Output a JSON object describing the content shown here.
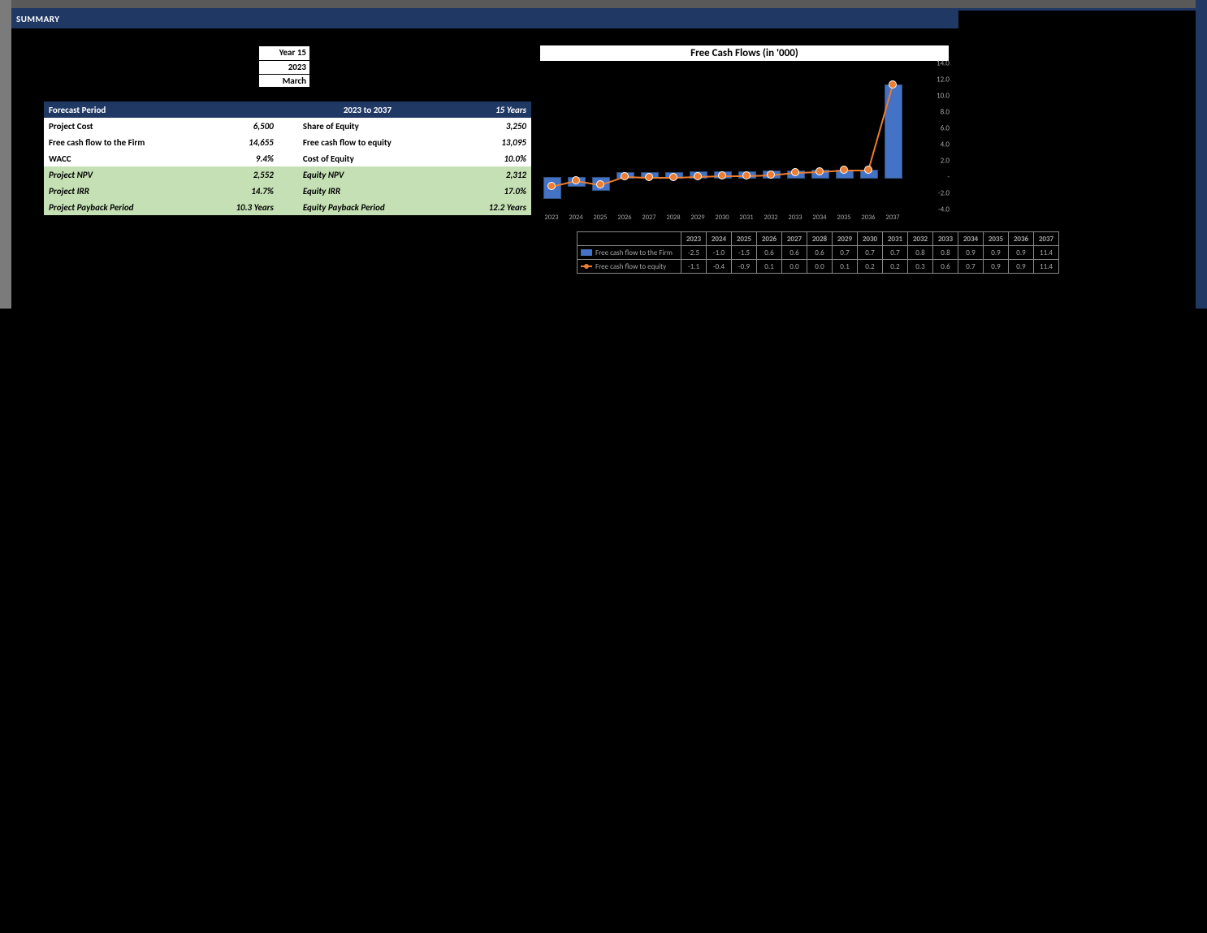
{
  "header": {
    "title": "SUMMARY",
    "box": {
      "line1": "Year 15",
      "line2": "2023",
      "line3": "March"
    }
  },
  "summary": {
    "forecast_period_label": "Forecast Period",
    "forecast_period_range": "2023 to 2037",
    "forecast_period_years": "15 Years",
    "rows": [
      {
        "l_label": "Project Cost",
        "l_value": "6,500",
        "r_label": "Share of Equity",
        "r_value": "3,250",
        "cls": "row-white"
      },
      {
        "l_label": "Free cash flow to the Firm",
        "l_value": "14,655",
        "r_label": "Free cash flow to equity",
        "r_value": "13,095",
        "cls": "row-white"
      },
      {
        "l_label": "WACC",
        "l_value": "9.4%",
        "r_label": "Cost of Equity",
        "r_value": "10.0%",
        "cls": "row-white"
      },
      {
        "l_label": "Project NPV",
        "l_value": "2,552",
        "r_label": "Equity NPV",
        "r_value": "2,312",
        "cls": "row-green"
      },
      {
        "l_label": "Project IRR",
        "l_value": "14.7%",
        "r_label": "Equity IRR",
        "r_value": "17.0%",
        "cls": "row-green"
      },
      {
        "l_label": "Project Payback Period",
        "l_value": "10.3 Years",
        "r_label": "Equity Payback Period",
        "r_value": "12.2 Years",
        "cls": "row-green"
      }
    ]
  },
  "chart_data": {
    "type": "bar",
    "title": "Free Cash Flows (in '000)",
    "categories": [
      "2023",
      "2024",
      "2025",
      "2026",
      "2027",
      "2028",
      "2029",
      "2030",
      "2031",
      "2032",
      "2033",
      "2034",
      "2035",
      "2036",
      "2037"
    ],
    "ylim": [
      -4.0,
      14.0
    ],
    "yticks": [
      "14.0",
      "12.0",
      "10.0",
      "8.0",
      "6.0",
      "4.0",
      "2.0",
      "-",
      "-2.0",
      "-4.0"
    ],
    "series": [
      {
        "name": "Free cash flow to the Firm",
        "kind": "bar",
        "values": [
          -2.5,
          -1.0,
          -1.5,
          0.6,
          0.6,
          0.6,
          0.7,
          0.7,
          0.7,
          0.8,
          0.8,
          0.9,
          0.9,
          0.9,
          11.4
        ]
      },
      {
        "name": "Free cash flow to equity",
        "kind": "line",
        "values": [
          -1.1,
          -0.4,
          -0.9,
          0.1,
          -0.0,
          0.0,
          0.1,
          0.2,
          0.2,
          0.3,
          0.6,
          0.7,
          0.9,
          0.9,
          11.4
        ]
      }
    ]
  }
}
